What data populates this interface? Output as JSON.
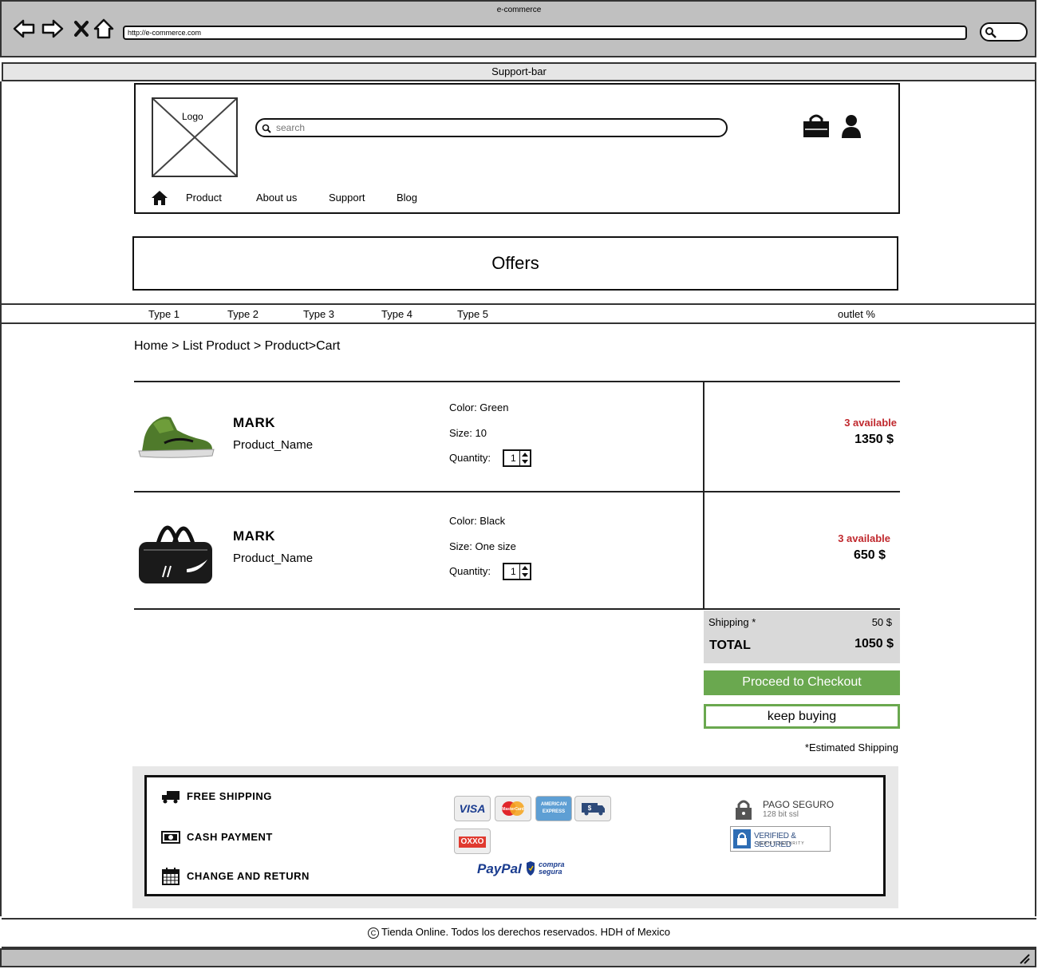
{
  "browser": {
    "title": "e-commerce",
    "url": "http://e-commerce.com"
  },
  "support_bar": "Support-bar",
  "header": {
    "logo_label": "Logo",
    "search_placeholder": "search",
    "menu": [
      "Product",
      "About us",
      "Support",
      "Blog"
    ]
  },
  "offers_label": "Offers",
  "types": [
    "Type 1",
    "Type 2",
    "Type 3",
    "Type 4",
    "Type 5"
  ],
  "outlet": "outlet %",
  "breadcrumb": "Home > List Product > Product>Cart",
  "cart": {
    "items": [
      {
        "brand": "MARK",
        "name": "Product_Name",
        "color": "Color: Green",
        "size": "Size: 10",
        "quantity_label": "Quantity:",
        "quantity": "1",
        "available": "3 available",
        "price": "1350 $",
        "image": "green-sneaker"
      },
      {
        "brand": "MARK",
        "name": "Product_Name",
        "color": "Color: Black",
        "size": "Size: One size",
        "quantity_label": "Quantity:",
        "quantity": "1",
        "available": "3 available",
        "price": "650 $",
        "image": "black-duffel-bag"
      }
    ],
    "shipping_label": "Shipping *",
    "shipping_value": "50 $",
    "total_label": "TOTAL",
    "total_value": "1050 $",
    "checkout_label": "Proceed to Checkout",
    "keep_label": "keep buying",
    "estimated_note": "*Estimated Shipping"
  },
  "footer": {
    "features": [
      "FREE SHIPPING",
      "CASH PAYMENT",
      "CHANGE AND RETURN"
    ],
    "payment_cards": [
      "VISA",
      "MasterCard",
      "AMERICAN EXPRESS",
      "$",
      "OXXO"
    ],
    "paypal": "PayPal",
    "compra_segura": "compra segura",
    "secure_title": "PAGO SEGURO",
    "secure_sub": "128 bit ssl",
    "verified": "VERIFIED & SECURED",
    "verified_sub": "VERIFY SECURITY"
  },
  "copyright": "Tienda Online. Todos los derechos reservados. HDH of Mexico",
  "colors": {
    "accent_green": "#6aa84f",
    "available_red": "#c0282d",
    "chrome_gray": "#c0c0c0"
  }
}
